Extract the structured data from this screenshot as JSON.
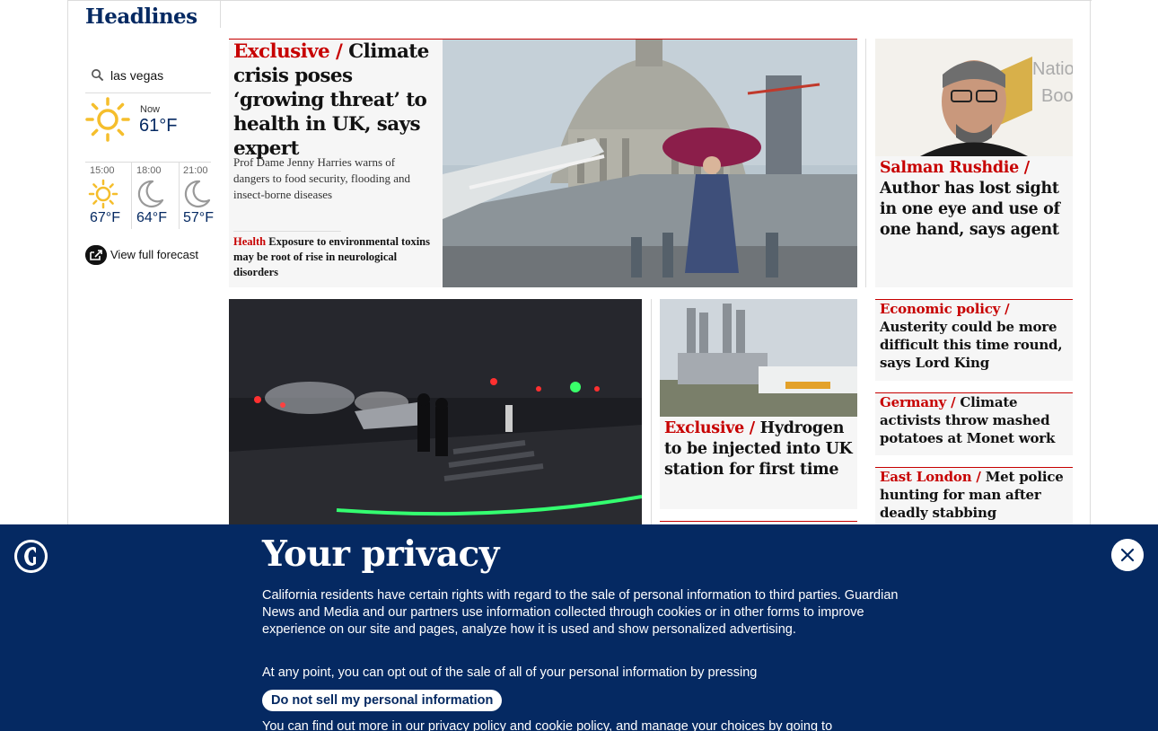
{
  "header": {
    "section_title": "Headlines"
  },
  "weather": {
    "location": "las vegas",
    "now": {
      "label": "Now",
      "temp": "61°F",
      "icon": "sun-icon"
    },
    "forecast": [
      {
        "time": "15:00",
        "temp": "67°F",
        "icon": "sun-icon"
      },
      {
        "time": "18:00",
        "temp": "64°F",
        "icon": "moon-icon"
      },
      {
        "time": "21:00",
        "temp": "57°F",
        "icon": "moon-icon"
      }
    ],
    "full_forecast_label": "View full forecast"
  },
  "cards": {
    "main": {
      "kicker": "Exclusive /",
      "title": "Climate crisis poses ‘growing threat’ to health in UK, says expert",
      "standfirst": "Prof Dame Jenny Harries warns of dangers to food security, flooding and insect-borne diseases",
      "related_kicker": "Health",
      "related_title": "Exposure to environmental toxins may be root of rise in neurological disorders"
    },
    "rushdie": {
      "kicker": "Salman Rushdie /",
      "title": "Author has lost sight in one eye and use of one hand, says agent"
    },
    "hydrogen": {
      "kicker": "Exclusive /",
      "title": "Hydrogen to be injected into UK station for first time"
    },
    "austerity": {
      "kicker": "Economic policy /",
      "title": "Austerity could be more difficult this time round, says Lord King"
    },
    "germany": {
      "kicker": "Germany /",
      "title": "Climate activists throw mashed potatoes at Monet work"
    },
    "east_london": {
      "kicker": "East London /",
      "title": "Met police hunting for man after deadly stabbing"
    }
  },
  "privacy": {
    "title": "Your privacy",
    "paragraph1": "California residents have certain rights with regard to the sale of personal information to third parties. Guardian News and Media and our partners use information collected through cookies or in other forms to improve experience on our site and pages, analyze how it is used and show personalized advertising.",
    "paragraph2": "At any point, you can opt out of the sale of all of your personal information by pressing",
    "button_label": "Do not sell my personal information",
    "paragraph3": "You can find out more in our privacy policy and cookie policy, and manage your choices by going to"
  },
  "colors": {
    "brand_blue": "#052962",
    "kicker_red": "#c70000",
    "card_bg": "#f6f6f6"
  }
}
